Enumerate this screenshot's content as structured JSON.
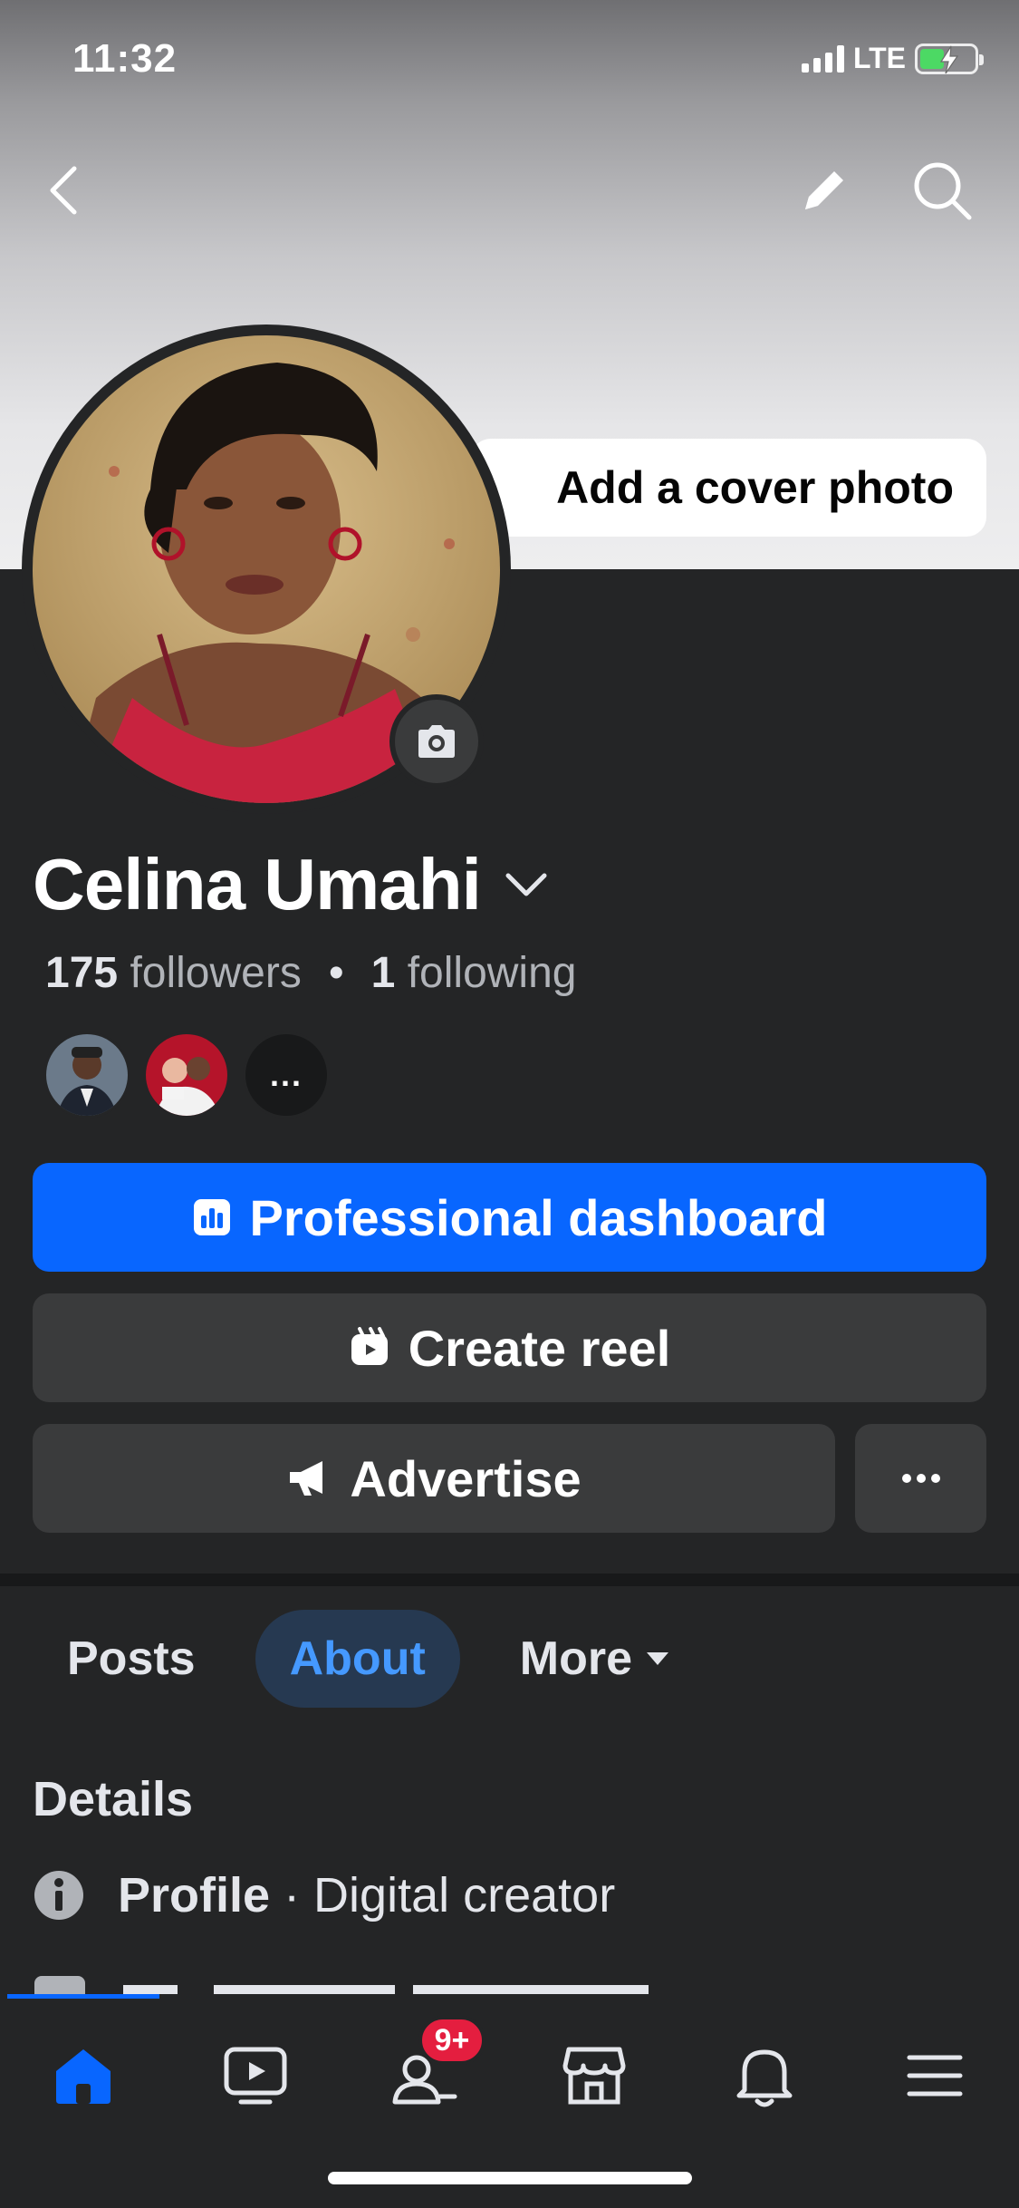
{
  "status_bar": {
    "time": "11:32",
    "network": "LTE"
  },
  "cover": {
    "add_cover_label": "Add a cover photo"
  },
  "profile": {
    "name": "Celina Umahi",
    "followers_count": "175",
    "followers_label": "followers",
    "following_count": "1",
    "following_label": "following",
    "friends_more": "..."
  },
  "actions": {
    "professional_dashboard": "Professional dashboard",
    "create_reel": "Create reel",
    "advertise": "Advertise",
    "more": "..."
  },
  "tabs": [
    {
      "label": "Posts",
      "active": false
    },
    {
      "label": "About",
      "active": true
    },
    {
      "label": "More",
      "active": false
    }
  ],
  "details": {
    "title": "Details",
    "profile_label": "Profile",
    "profile_value": "· Digital creator"
  },
  "bottom_nav": {
    "items": [
      "home-icon",
      "video-icon",
      "friends-icon",
      "marketplace-icon",
      "bell-icon",
      "menu-icon"
    ],
    "friends_badge": "9+"
  },
  "colors": {
    "accent": "#0866ff",
    "background": "#242526",
    "surface": "#3a3b3c",
    "badge": "#e41e3f"
  }
}
